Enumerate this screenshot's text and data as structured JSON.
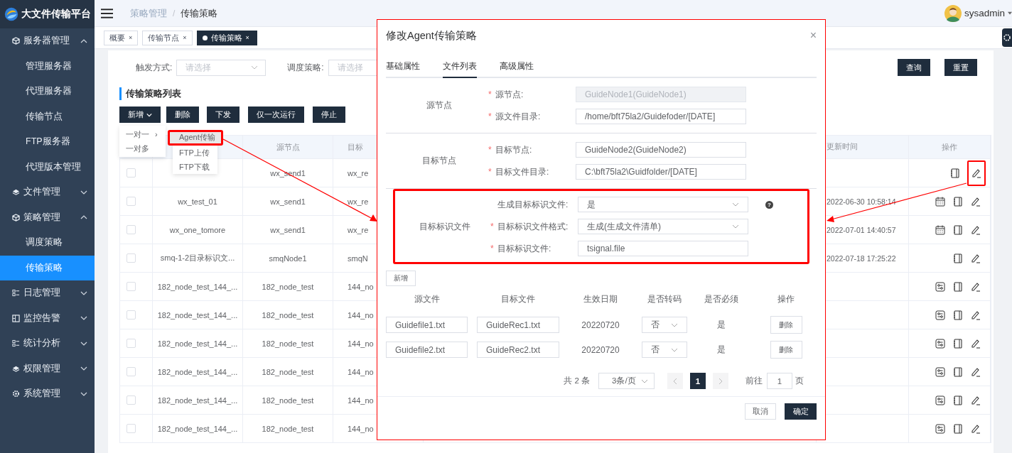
{
  "header": {
    "app_title": "大文件传输平台",
    "breadcrumb": [
      "策略管理",
      "传输策略"
    ],
    "separator": "/",
    "user": "sysadmin"
  },
  "sidebar": {
    "items": [
      {
        "label": "服务器管理",
        "expanded": true,
        "children": [
          {
            "label": "管理服务器",
            "selected": false
          },
          {
            "label": "代理服务器",
            "selected": false
          },
          {
            "label": "传输节点",
            "selected": false
          },
          {
            "label": "FTP服务器",
            "selected": false
          },
          {
            "label": "代理版本管理",
            "selected": false
          }
        ]
      },
      {
        "label": "文件管理",
        "expanded": false
      },
      {
        "label": "策略管理",
        "expanded": true,
        "children": [
          {
            "label": "调度策略",
            "selected": false
          },
          {
            "label": "传输策略",
            "selected": true
          }
        ]
      },
      {
        "label": "日志管理",
        "expanded": false
      },
      {
        "label": "监控告警",
        "expanded": false
      },
      {
        "label": "统计分析",
        "expanded": false
      },
      {
        "label": "权限管理",
        "expanded": false
      },
      {
        "label": "系统管理",
        "expanded": false
      }
    ]
  },
  "tabs": [
    {
      "label": "概要",
      "selected": false,
      "close": "×"
    },
    {
      "label": "传输节点",
      "selected": false,
      "close": "×"
    },
    {
      "label": "传输策略",
      "selected": true,
      "close": "×"
    }
  ],
  "filters": [
    {
      "label": "触发方式:",
      "placeholder": "请选择"
    },
    {
      "label": "调度策略:",
      "placeholder": "请选择"
    }
  ],
  "search_buttons": [
    "查询",
    "重置"
  ],
  "list_title": "传输策略列表",
  "toolbar": [
    {
      "label": "新增",
      "kind": "dropdown"
    },
    {
      "label": "删除",
      "kind": "plain"
    },
    {
      "label": "下发",
      "kind": "plain"
    },
    {
      "label": "仅一次运行",
      "kind": "plain"
    },
    {
      "label": "停止",
      "kind": "plain"
    }
  ],
  "add_menu": {
    "items": [
      {
        "label": "一对一",
        "submenu": "›"
      },
      {
        "label": "一对多"
      }
    ],
    "submenu": [
      {
        "label": "Agent传输",
        "selected": true,
        "annotated": true
      },
      {
        "label": "FTP上传",
        "selected": false,
        "annotated": false
      },
      {
        "label": "FTP下载",
        "selected": false,
        "annotated": false
      }
    ]
  },
  "table": {
    "columns": {
      "source": "源节点",
      "target": "目标",
      "time": "更新时间",
      "actions": "操作"
    },
    "rows": [
      {
        "checked": false,
        "source": "wx_send1",
        "target": "wx_re",
        "actions": [
          {
            "kind": "notebook"
          },
          {
            "kind": "edit"
          }
        ],
        "annotated": true
      },
      {
        "checked": false,
        "name": "wx_test_01",
        "source": "wx_send1",
        "target": "wx_re",
        "time": "2022-06-30 10:58:14",
        "actions": [
          {
            "kind": "calendar"
          },
          {
            "kind": "notebook"
          },
          {
            "kind": "edit"
          }
        ],
        "annotated": false
      },
      {
        "checked": false,
        "name": "wx_one_tomore",
        "source": "wx_send1",
        "target": "wx_re",
        "time": "2022-07-01 14:40:57",
        "actions": [
          {
            "kind": "calendar"
          },
          {
            "kind": "notebook"
          },
          {
            "kind": "edit"
          }
        ],
        "annotated": false
      },
      {
        "checked": false,
        "name": "smq-1-2目录标识文...",
        "source": "smqNode1",
        "target": "smqN",
        "time": "2022-07-18 17:25:22",
        "actions": [
          {
            "kind": "notebook"
          },
          {
            "kind": "edit"
          }
        ],
        "annotated": false
      },
      {
        "checked": false,
        "name": "182_node_test_144_...",
        "source": "182_node_test",
        "target": "144_no",
        "actions": [
          {
            "kind": "flow"
          },
          {
            "kind": "notebook"
          },
          {
            "kind": "edit"
          }
        ],
        "annotated": false
      },
      {
        "checked": false,
        "name": "182_node_test_144_...",
        "source": "182_node_test",
        "target": "144_no",
        "actions": [
          {
            "kind": "flow"
          },
          {
            "kind": "notebook"
          },
          {
            "kind": "edit"
          }
        ],
        "annotated": false
      },
      {
        "checked": false,
        "name": "182_node_test_144_...",
        "source": "182_node_test",
        "target": "144_no",
        "actions": [
          {
            "kind": "flow"
          },
          {
            "kind": "notebook"
          },
          {
            "kind": "edit"
          }
        ],
        "annotated": false
      },
      {
        "checked": false,
        "name": "182_node_test_144_...",
        "source": "182_node_test",
        "target": "144_no",
        "actions": [
          {
            "kind": "flow"
          },
          {
            "kind": "notebook"
          },
          {
            "kind": "edit"
          }
        ],
        "annotated": false
      },
      {
        "checked": false,
        "name": "182_node_test_144_...",
        "source": "182_node_test",
        "target": "144_no",
        "actions": [
          {
            "kind": "flow"
          },
          {
            "kind": "notebook"
          },
          {
            "kind": "edit"
          }
        ],
        "annotated": false
      },
      {
        "checked": false,
        "name": "182_node_test_144_...",
        "source": "182_node_test",
        "target": "144_no",
        "actions": [
          {
            "kind": "flow"
          },
          {
            "kind": "notebook"
          },
          {
            "kind": "edit"
          }
        ],
        "annotated": false
      }
    ]
  },
  "dialog": {
    "title": "修改Agent传输策略",
    "close": "×",
    "tabs": [
      {
        "label": "基础属性",
        "selected": false
      },
      {
        "label": "文件列表",
        "selected": true
      },
      {
        "label": "高级属性",
        "selected": false
      }
    ],
    "sections": [
      {
        "title": "源节点",
        "highlighted": false,
        "fields": [
          {
            "label": "源节点:",
            "required_mark": "*",
            "kind": "input",
            "value": "GuideNode1(GuideNode1)",
            "disabled": true
          },
          {
            "label": "源文件目录:",
            "required_mark": "*",
            "kind": "input",
            "value": "/home/bft75la2/Guidefoder/[DATE]",
            "disabled": false
          }
        ]
      },
      {
        "title": "目标节点",
        "highlighted": false,
        "fields": [
          {
            "label": "目标节点:",
            "required_mark": "*",
            "kind": "input",
            "value": "GuideNode2(GuideNode2)",
            "disabled": false
          },
          {
            "label": "目标文件目录:",
            "required_mark": "*",
            "kind": "input",
            "value": "C:\\bft75la2\\Guidfolder/[DATE]",
            "disabled": false
          }
        ]
      },
      {
        "title": "目标标识文件",
        "highlighted": true,
        "fields": [
          {
            "label": "生成目标标识文件:",
            "kind": "select",
            "value": "是",
            "help": "?"
          },
          {
            "label": "目标标识文件格式:",
            "required_mark": "*",
            "kind": "select",
            "value": "生成(生成文件清单)"
          },
          {
            "label": "目标标识文件:",
            "required_mark": "*",
            "kind": "input",
            "value": "tsignal.file",
            "disabled": false
          }
        ]
      }
    ],
    "add_button": "新增",
    "files": {
      "columns": [
        "源文件",
        "目标文件",
        "生效日期",
        "是否转码",
        "是否必须",
        "操作"
      ],
      "rows": [
        {
          "source": "Guidefile1.txt",
          "target": "GuideRec1.txt",
          "date": "20220720",
          "transcode": "否",
          "required": "是",
          "action": "删除"
        },
        {
          "source": "Guidefile2.txt",
          "target": "GuideRec2.txt",
          "date": "20220720",
          "transcode": "否",
          "required": "是",
          "action": "删除"
        }
      ]
    },
    "pagination": {
      "total": "共 2 条",
      "page_size": "3条/页",
      "pages": [
        {
          "label": "1",
          "selected": true
        }
      ],
      "goto_label": "前往",
      "goto_value": "1",
      "page_suffix": "页"
    },
    "buttons": [
      {
        "label": "取消",
        "kind": "plain"
      },
      {
        "label": "确定",
        "kind": "primary"
      }
    ]
  }
}
